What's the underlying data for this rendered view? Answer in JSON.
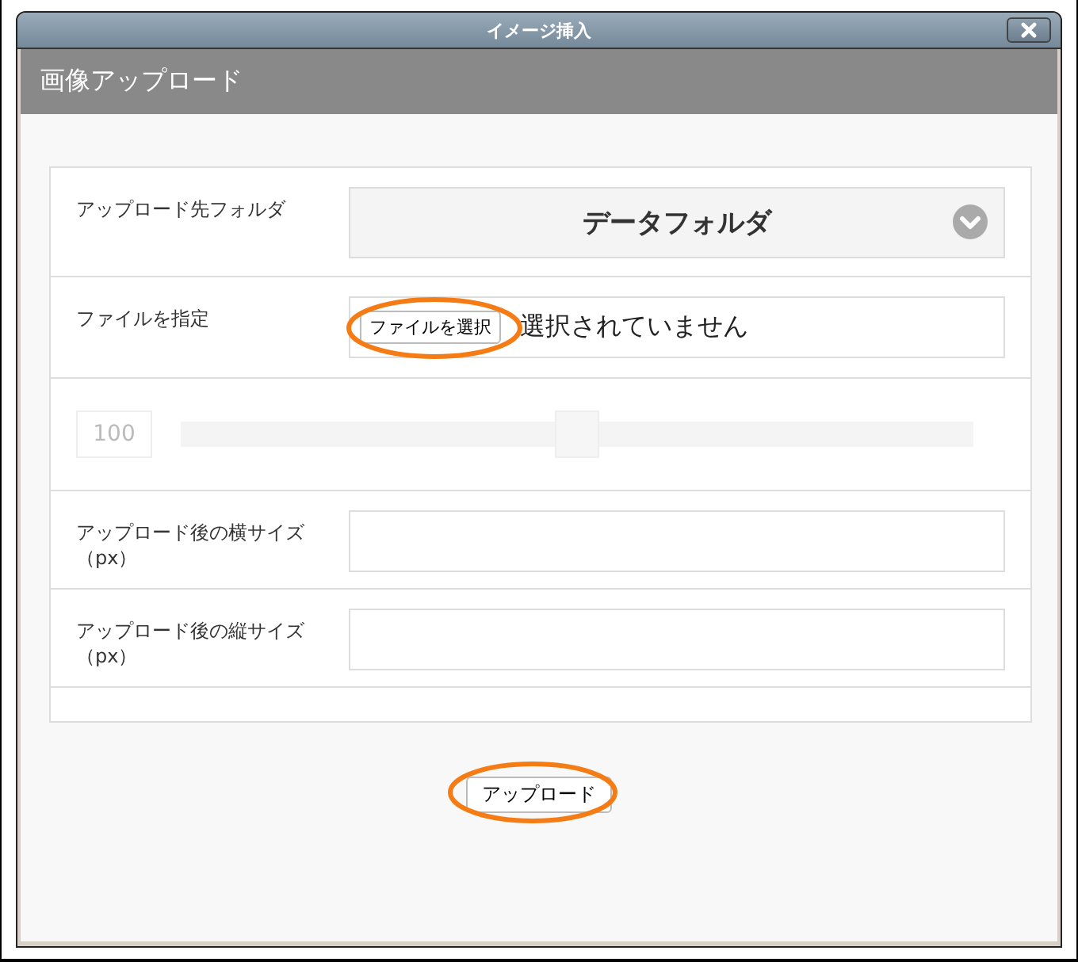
{
  "dialog": {
    "title": "イメージ挿入",
    "header": "画像アップロード",
    "fields": [
      {
        "kind": "select",
        "label": "アップロード先フォルダ",
        "value": "データフォルダ"
      },
      {
        "kind": "file",
        "label": "ファイルを指定",
        "button": "ファイルを選択",
        "status": "選択されていません",
        "highlighted": true
      },
      {
        "kind": "slider",
        "value": "100",
        "level": 0.5,
        "disabled": true
      },
      {
        "kind": "text",
        "label": "アップロード後の横サイズ（px）"
      },
      {
        "kind": "text",
        "label": "アップロード後の縦サイズ（px）"
      },
      {
        "kind": "empty"
      }
    ],
    "upload_button": {
      "label": "アップロード",
      "highlighted": true
    }
  }
}
